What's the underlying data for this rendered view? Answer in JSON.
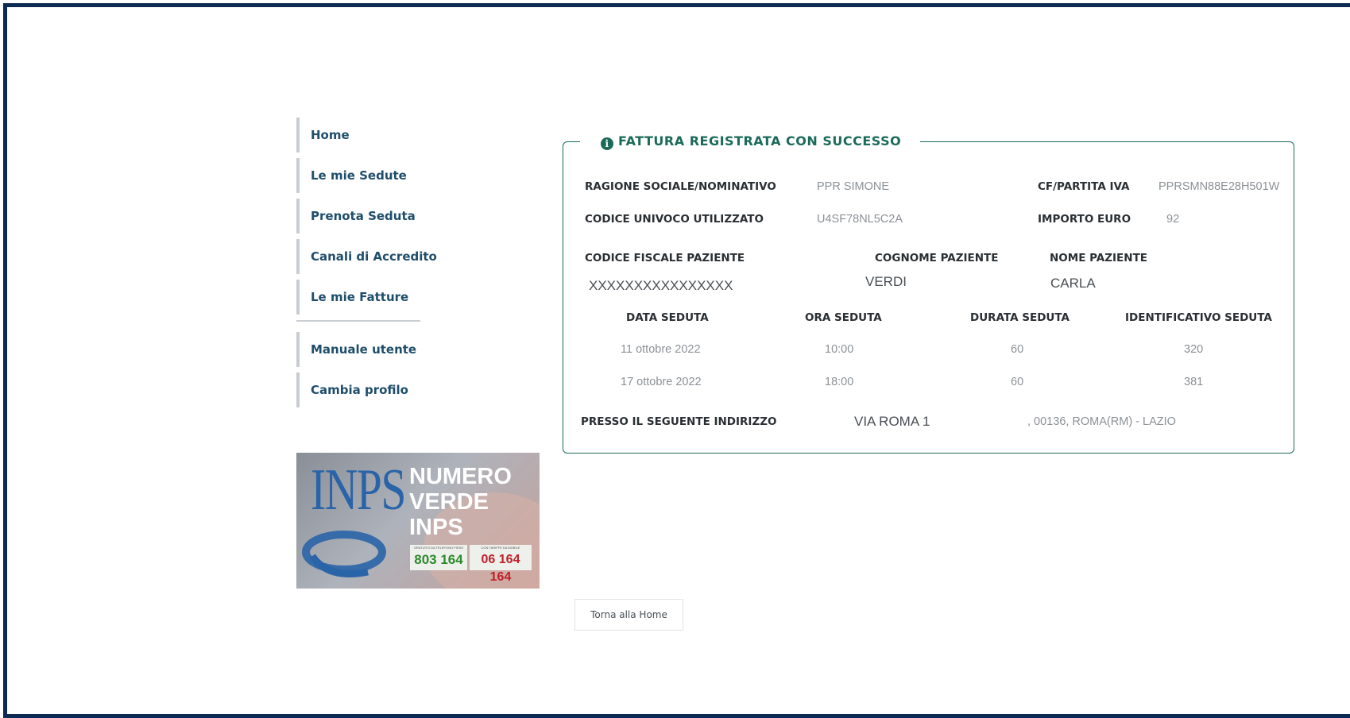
{
  "nav": {
    "items": [
      "Home",
      "Le mie Sedute",
      "Prenota Seduta",
      "Canali di Accredito",
      "Le mie Fatture"
    ],
    "secondary": [
      "Manuale utente",
      "Cambia profilo"
    ]
  },
  "banner": {
    "logo": "INPS",
    "line1": "NUMERO",
    "line2": "VERDE",
    "line3": "INPS",
    "small1": "GRATUITO DA TELEFONO FISSO",
    "small2": "CON TARIFFE DA MOBILE",
    "num1": "803 164",
    "num2": "06 164 164"
  },
  "card": {
    "title": "FATTURA REGISTRATA CON SUCCESSO",
    "icon": "info-icon",
    "ragione_label": "RAGIONE SOCIALE/NOMINATIVO",
    "ragione_value": "PPR SIMONE",
    "cf_label": "CF/PARTITA IVA",
    "cf_value": "PPRSMN88E28H501W",
    "codice_label": "CODICE UNIVOCO UTILIZZATO",
    "codice_value": "U4SF78NL5C2A",
    "importo_label": "IMPORTO EURO",
    "importo_value": "92",
    "cf_paziente_label": "CODICE FISCALE PAZIENTE",
    "cf_paziente_value": "XXXXXXXXXXXXXXXX",
    "cognome_label": "COGNOME PAZIENTE",
    "cognome_value": "VERDI",
    "nome_label": "NOME PAZIENTE",
    "nome_value": "CARLA",
    "sessions_headers": [
      "DATA SEDUTA",
      "ORA SEDUTA",
      "DURATA SEDUTA",
      "IDENTIFICATIVO SEDUTA"
    ],
    "sessions": [
      [
        "11 ottobre 2022",
        "10:00",
        "60",
        "320"
      ],
      [
        "17 ottobre 2022",
        "18:00",
        "60",
        "381"
      ]
    ],
    "indirizzo_label": "PRESSO IL SEGUENTE INDIRIZZO",
    "indirizzo_value": "VIA ROMA 1",
    "indirizzo_city": ", 00136, ROMA(RM) - LAZIO"
  },
  "button": {
    "home": "Torna alla Home"
  }
}
